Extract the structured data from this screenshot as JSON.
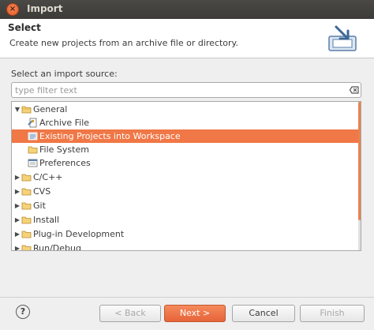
{
  "window": {
    "title": "Import"
  },
  "header": {
    "title": "Select",
    "description": "Create new projects from an archive file or directory."
  },
  "source_label": "Select an import source:",
  "filter": {
    "placeholder": "type filter text",
    "value": ""
  },
  "tree": {
    "rows": [
      {
        "label": "General",
        "arrow": "▼",
        "icon": "folder-icon",
        "level": 0
      },
      {
        "label": "Archive File",
        "arrow": "",
        "icon": "archive-file-icon",
        "level": 1
      },
      {
        "label": "Existing Projects into Workspace",
        "arrow": "",
        "icon": "project-icon",
        "level": 1,
        "selected": true
      },
      {
        "label": "File System",
        "arrow": "",
        "icon": "folder-icon",
        "level": 1
      },
      {
        "label": "Preferences",
        "arrow": "",
        "icon": "preferences-icon",
        "level": 1
      },
      {
        "label": "C/C++",
        "arrow": "▶",
        "icon": "folder-icon",
        "level": 0
      },
      {
        "label": "CVS",
        "arrow": "▶",
        "icon": "folder-icon",
        "level": 0
      },
      {
        "label": "Git",
        "arrow": "▶",
        "icon": "folder-icon",
        "level": 0
      },
      {
        "label": "Install",
        "arrow": "▶",
        "icon": "folder-icon",
        "level": 0
      },
      {
        "label": "Plug-in Development",
        "arrow": "▶",
        "icon": "folder-icon",
        "level": 0
      },
      {
        "label": "Run/Debug",
        "arrow": "▶",
        "icon": "folder-icon",
        "level": 0
      }
    ]
  },
  "buttons": {
    "help": "?",
    "back": "< Back",
    "next": "Next >",
    "cancel": "Cancel",
    "finish": "Finish"
  },
  "colors": {
    "accent": "#f07746",
    "title_bar": "#3c3b37"
  }
}
